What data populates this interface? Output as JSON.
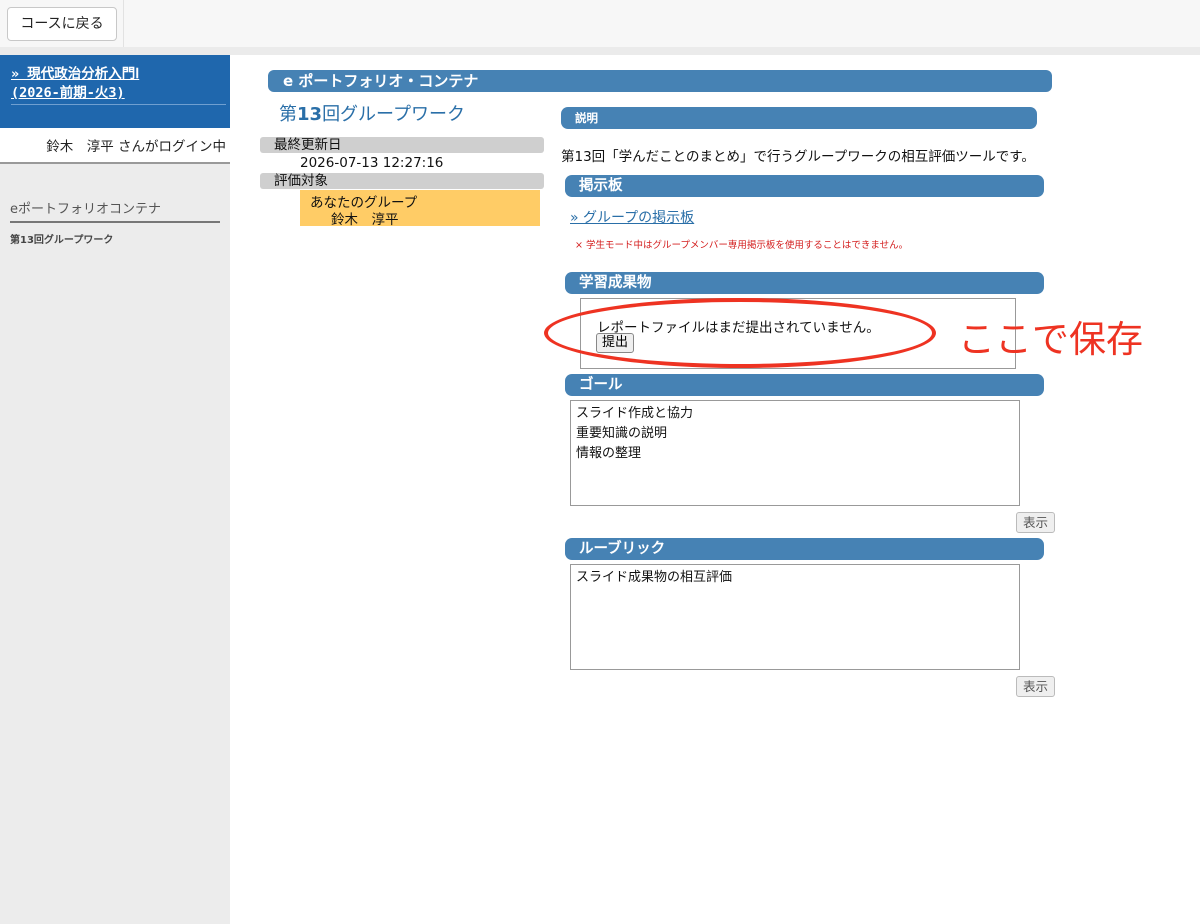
{
  "topbar": {
    "back_label": "コースに戻る"
  },
  "sidebar": {
    "course_link_line1": "» 現代政治分析入門Ⅰ",
    "course_link_line2": "(2026-前期-火3)",
    "login_text": "鈴木　淳平 さんがログイン中",
    "section_title": "eポートフォリオコンテナ",
    "section_item": "第13回グループワーク"
  },
  "main": {
    "header": "e ポートフォリオ・コンテナ",
    "title_prefix": "第",
    "title_number": "13",
    "title_suffix": "回グループワーク",
    "last_updated_label": "最終更新日",
    "last_updated_value": "2026-07-13 12:27:16",
    "target_label": "評価対象",
    "group_name": "あなたのグループ",
    "group_member": "鈴木　淳平"
  },
  "description": {
    "heading": "説明",
    "text": "第13回「学んだことのまとめ」で行うグループワークの相互評価ツールです。"
  },
  "board": {
    "heading": "掲示板",
    "link": "» グループの掲示板",
    "note": "× 学生モード中はグループメンバー専用掲示板を使用することはできません。"
  },
  "deliverables": {
    "heading": "学習成果物",
    "message": "レポートファイルはまだ提出されていません。",
    "submit_label": "提出"
  },
  "annotation": {
    "text": "ここで保存",
    "color": "#ee3322"
  },
  "goals": {
    "heading": "ゴール",
    "items": [
      "スライド作成と協力",
      "重要知識の説明",
      "情報の整理"
    ],
    "show_label": "表示"
  },
  "rubric": {
    "heading": "ルーブリック",
    "items": [
      "スライド成果物の相互評価"
    ],
    "show_label": "表示"
  },
  "colors": {
    "accent": "#4682b4",
    "sidebar_brand": "#1f67ad",
    "group_highlight": "#ffcc66"
  }
}
